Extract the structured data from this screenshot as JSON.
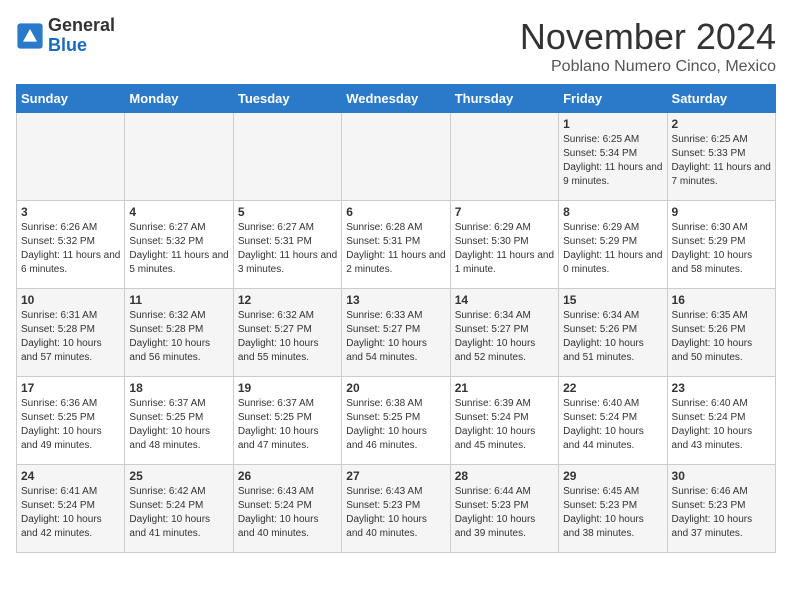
{
  "header": {
    "logo_general": "General",
    "logo_blue": "Blue",
    "month": "November 2024",
    "location": "Poblano Numero Cinco, Mexico"
  },
  "days_of_week": [
    "Sunday",
    "Monday",
    "Tuesday",
    "Wednesday",
    "Thursday",
    "Friday",
    "Saturday"
  ],
  "weeks": [
    [
      {
        "day": "",
        "info": ""
      },
      {
        "day": "",
        "info": ""
      },
      {
        "day": "",
        "info": ""
      },
      {
        "day": "",
        "info": ""
      },
      {
        "day": "",
        "info": ""
      },
      {
        "day": "1",
        "info": "Sunrise: 6:25 AM\nSunset: 5:34 PM\nDaylight: 11 hours and 9 minutes."
      },
      {
        "day": "2",
        "info": "Sunrise: 6:25 AM\nSunset: 5:33 PM\nDaylight: 11 hours and 7 minutes."
      }
    ],
    [
      {
        "day": "3",
        "info": "Sunrise: 6:26 AM\nSunset: 5:32 PM\nDaylight: 11 hours and 6 minutes."
      },
      {
        "day": "4",
        "info": "Sunrise: 6:27 AM\nSunset: 5:32 PM\nDaylight: 11 hours and 5 minutes."
      },
      {
        "day": "5",
        "info": "Sunrise: 6:27 AM\nSunset: 5:31 PM\nDaylight: 11 hours and 3 minutes."
      },
      {
        "day": "6",
        "info": "Sunrise: 6:28 AM\nSunset: 5:31 PM\nDaylight: 11 hours and 2 minutes."
      },
      {
        "day": "7",
        "info": "Sunrise: 6:29 AM\nSunset: 5:30 PM\nDaylight: 11 hours and 1 minute."
      },
      {
        "day": "8",
        "info": "Sunrise: 6:29 AM\nSunset: 5:29 PM\nDaylight: 11 hours and 0 minutes."
      },
      {
        "day": "9",
        "info": "Sunrise: 6:30 AM\nSunset: 5:29 PM\nDaylight: 10 hours and 58 minutes."
      }
    ],
    [
      {
        "day": "10",
        "info": "Sunrise: 6:31 AM\nSunset: 5:28 PM\nDaylight: 10 hours and 57 minutes."
      },
      {
        "day": "11",
        "info": "Sunrise: 6:32 AM\nSunset: 5:28 PM\nDaylight: 10 hours and 56 minutes."
      },
      {
        "day": "12",
        "info": "Sunrise: 6:32 AM\nSunset: 5:27 PM\nDaylight: 10 hours and 55 minutes."
      },
      {
        "day": "13",
        "info": "Sunrise: 6:33 AM\nSunset: 5:27 PM\nDaylight: 10 hours and 54 minutes."
      },
      {
        "day": "14",
        "info": "Sunrise: 6:34 AM\nSunset: 5:27 PM\nDaylight: 10 hours and 52 minutes."
      },
      {
        "day": "15",
        "info": "Sunrise: 6:34 AM\nSunset: 5:26 PM\nDaylight: 10 hours and 51 minutes."
      },
      {
        "day": "16",
        "info": "Sunrise: 6:35 AM\nSunset: 5:26 PM\nDaylight: 10 hours and 50 minutes."
      }
    ],
    [
      {
        "day": "17",
        "info": "Sunrise: 6:36 AM\nSunset: 5:25 PM\nDaylight: 10 hours and 49 minutes."
      },
      {
        "day": "18",
        "info": "Sunrise: 6:37 AM\nSunset: 5:25 PM\nDaylight: 10 hours and 48 minutes."
      },
      {
        "day": "19",
        "info": "Sunrise: 6:37 AM\nSunset: 5:25 PM\nDaylight: 10 hours and 47 minutes."
      },
      {
        "day": "20",
        "info": "Sunrise: 6:38 AM\nSunset: 5:25 PM\nDaylight: 10 hours and 46 minutes."
      },
      {
        "day": "21",
        "info": "Sunrise: 6:39 AM\nSunset: 5:24 PM\nDaylight: 10 hours and 45 minutes."
      },
      {
        "day": "22",
        "info": "Sunrise: 6:40 AM\nSunset: 5:24 PM\nDaylight: 10 hours and 44 minutes."
      },
      {
        "day": "23",
        "info": "Sunrise: 6:40 AM\nSunset: 5:24 PM\nDaylight: 10 hours and 43 minutes."
      }
    ],
    [
      {
        "day": "24",
        "info": "Sunrise: 6:41 AM\nSunset: 5:24 PM\nDaylight: 10 hours and 42 minutes."
      },
      {
        "day": "25",
        "info": "Sunrise: 6:42 AM\nSunset: 5:24 PM\nDaylight: 10 hours and 41 minutes."
      },
      {
        "day": "26",
        "info": "Sunrise: 6:43 AM\nSunset: 5:24 PM\nDaylight: 10 hours and 40 minutes."
      },
      {
        "day": "27",
        "info": "Sunrise: 6:43 AM\nSunset: 5:23 PM\nDaylight: 10 hours and 40 minutes."
      },
      {
        "day": "28",
        "info": "Sunrise: 6:44 AM\nSunset: 5:23 PM\nDaylight: 10 hours and 39 minutes."
      },
      {
        "day": "29",
        "info": "Sunrise: 6:45 AM\nSunset: 5:23 PM\nDaylight: 10 hours and 38 minutes."
      },
      {
        "day": "30",
        "info": "Sunrise: 6:46 AM\nSunset: 5:23 PM\nDaylight: 10 hours and 37 minutes."
      }
    ]
  ]
}
